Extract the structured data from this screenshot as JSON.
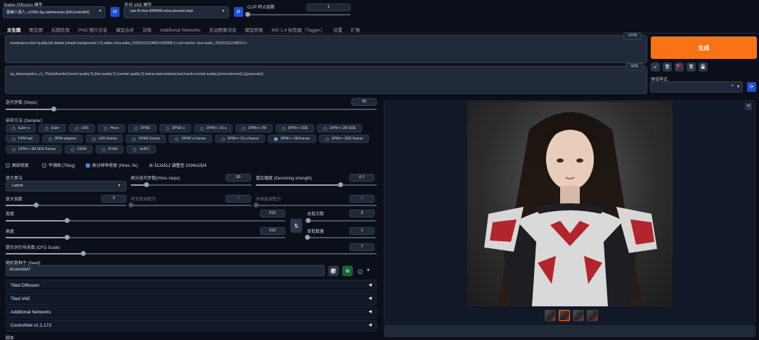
{
  "header": {
    "model_label": "Stable Diffusion 模型",
    "model_value": "墨幽人造人_v1050-3g.safetensors [b0c1edcdb9]",
    "vae_label": "外挂 VAE 模型",
    "vae_value": "vae-ft-mse-840000-ema-pruned.ckpt",
    "clip_label": "CLIP 终止层数",
    "clip_value": "1",
    "clip_fraction": 0.0
  },
  "tabs": [
    "文生图",
    "图生图",
    "后期处理",
    "PNG 图片信息",
    "模型合并",
    "训练",
    "Additional Networks",
    "无边图像浏览",
    "模型转换",
    "WD 1.4 标签器（Tagger）",
    "设置",
    "扩展"
  ],
  "prompt": {
    "positive": "masterpiece,best quality,full details,(simple background:1.2),saibo,<lora:saibo_20231011224803-000008:1>,red mecha <lora:saibo_20231011224803:1>",
    "positive_count": "17/75",
    "negative": "ng_deepnegative_v1_75t,badhandv4,(worst quality:2),(low quality:2),(normal quality:2),lowres,bad anatomy,bad hands,normal quality,((monochrome)),((grayscale))",
    "negative_count": "0/75"
  },
  "actions": {
    "generate_label": "生成",
    "styles_label": "预设样式",
    "styles_clear": "×",
    "styles_arrow": "▾",
    "tools": [
      "↙",
      "🗑",
      "🚩",
      "🗑",
      "💾"
    ]
  },
  "steps": {
    "label": "迭代步数 (Steps)",
    "value": "20",
    "fraction": 0.13
  },
  "sampler": {
    "label": "采样方法 (Sampler)",
    "options": [
      "Euler a",
      "Euler",
      "LMS",
      "Heun",
      "DPM2",
      "DPM2 a",
      "DPM++ 2S a",
      "DPM++ 2M",
      "DPM++ SDE",
      "DPM++ 2M SDE",
      "DPM fast",
      "DPM adaptive",
      "LMS Karras",
      "DPM2 Karras",
      "DPM2 a Karras",
      "DPM++ 2S a Karras",
      "DPM++ 2M Karras",
      "DPM++ SDE Karras",
      "DPM++ 2M SDE Karras",
      "DDIM",
      "PLMS",
      "UniPC"
    ],
    "selected": "DPM++ 2M Karras"
  },
  "checks": {
    "face_restore": "面部修复",
    "tiling": "平铺图 (Tiling)",
    "hires": "高分辨率修复 (Hires. fix)",
    "hires_info": "从 512x512 调整至 1024x1024"
  },
  "hires": {
    "upscaler_label": "放大算法",
    "upscaler_value": "Latent",
    "hires_steps_label": "高分迭代步数(Hires steps)",
    "hires_steps_value": "20",
    "hires_steps_fraction": 0.13,
    "denoise_label": "重绘幅度 (Denoising strength)",
    "denoise_value": "0.7",
    "denoise_fraction": 0.7,
    "upscale_label": "放大倍数",
    "upscale_value": "2",
    "upscale_fraction": 0.25,
    "resize_w_label": "将宽度调整为",
    "resize_w_value": "0",
    "resize_h_label": "将高度调整为",
    "resize_h_value": "0"
  },
  "size": {
    "width_label": "宽度",
    "width_value": "512",
    "width_fraction": 0.22,
    "height_label": "高度",
    "height_value": "512",
    "height_fraction": 0.22,
    "swap_icon": "⇅",
    "batch_count_label": "总批次数",
    "batch_count_value": "3",
    "batch_count_fraction": 0.02,
    "batch_size_label": "单批数量",
    "batch_size_value": "1",
    "batch_size_fraction": 0.0
  },
  "cfg": {
    "label": "提示词引导系数 (CFG Scale)",
    "value": "7",
    "fraction": 0.21
  },
  "seed": {
    "label": "随机数种子 (Seed)",
    "value": "2616642567",
    "dice": "🎲",
    "recycle": "♻",
    "extra": "▼"
  },
  "accordions": [
    {
      "label": "Tiled Diffusion",
      "arrow": "◀"
    },
    {
      "label": "Tiled VAE",
      "arrow": "◀"
    },
    {
      "label": "Additional Networks",
      "arrow": "◀"
    },
    {
      "label": "ControlNet v1.1.173",
      "arrow": "◀"
    }
  ],
  "script_label": "脚本",
  "gallery": {
    "close": "×",
    "thumb_count": 4,
    "selected_thumb": 1
  },
  "colors": {
    "accent": "#f97316",
    "background": "#0b0f19",
    "panel": "#1f2937"
  }
}
